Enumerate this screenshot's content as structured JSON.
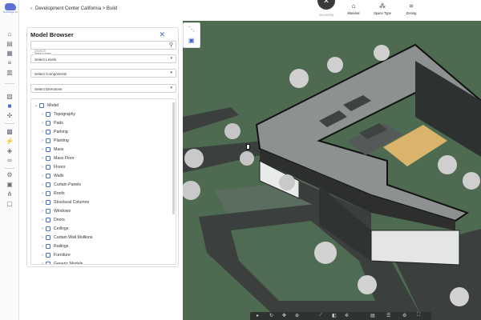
{
  "app": {
    "logo_text": "BuildSage AI"
  },
  "header": {
    "back_icon": "chevron-left-icon",
    "breadcrumb": "Development Center California > Build",
    "mode_tabs": [
      {
        "label": "Geometry",
        "icon": "close-icon"
      },
      {
        "label": "Material",
        "icon": "bank-icon"
      },
      {
        "label": "Space Type",
        "icon": "shapes-icon"
      },
      {
        "label": "Zoning",
        "icon": "frame-icon"
      }
    ]
  },
  "model_browser": {
    "title": "Model Browser",
    "search": {
      "value": "",
      "placeholder": "Search"
    },
    "filters": [
      {
        "label": "Select Levels",
        "value": "Select Levels"
      },
      {
        "label": "",
        "value": "Select Components"
      },
      {
        "label": "",
        "value": "Select Directions"
      }
    ],
    "tree": {
      "root": "Model",
      "items": [
        "Topography",
        "Pads",
        "Parking",
        "Planting",
        "Mass",
        "Mass Floor",
        "Floors",
        "Walls",
        "Curtain Panels",
        "Roofs",
        "Structural Columns",
        "Windows",
        "Doors",
        "Ceilings",
        "Curtain Wall Mullions",
        "Railings",
        "Furniture",
        "Generic Models"
      ]
    }
  },
  "colors": {
    "accent": "#3f66d0",
    "ground": "#4e6b52",
    "roof": "#8e9192",
    "courtyard": "#d9b46a",
    "facade": "#2c2f2e"
  }
}
